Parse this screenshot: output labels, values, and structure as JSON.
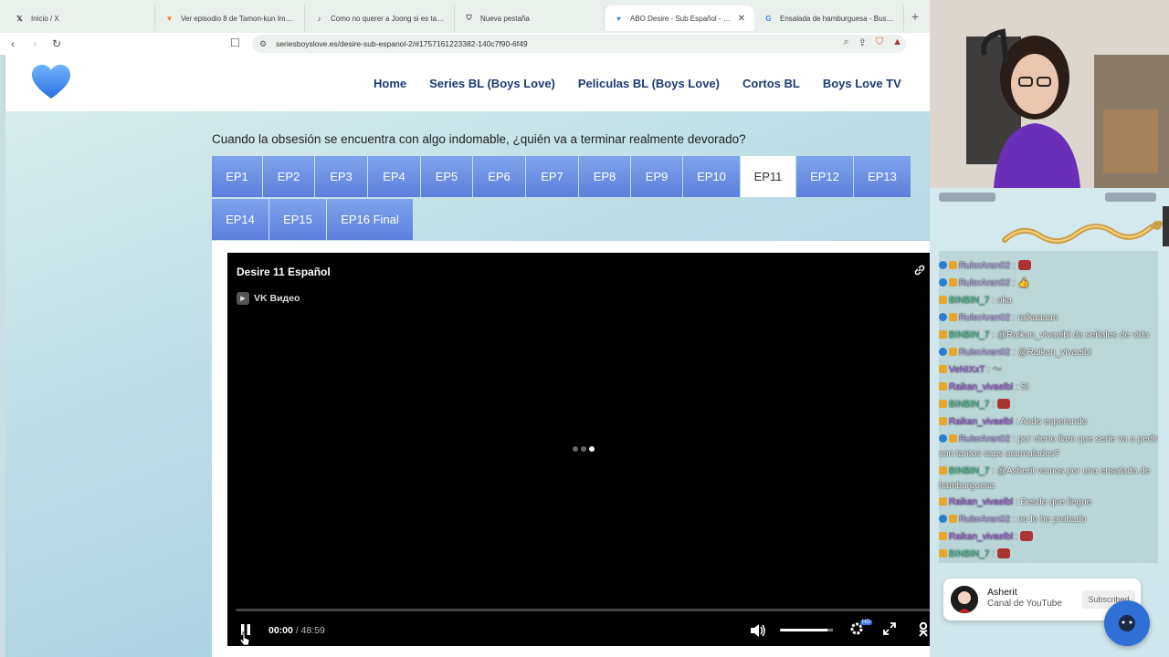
{
  "browser": {
    "tabs": [
      {
        "title": "Inicio / X",
        "favicon": "x-logo-icon",
        "active": false
      },
      {
        "title": "Ver episodio 8 de Tamon-kun Ima Do",
        "favicon": "crunchyroll-icon",
        "active": false
      },
      {
        "title": "Como no querer a Joong si es tan pr",
        "favicon": "tiktok-icon",
        "active": false
      },
      {
        "title": "Nueva pestaña",
        "favicon": "shield-icon",
        "active": false
      },
      {
        "title": "ABO Desire - Sub Español - Serie",
        "favicon": "heart-icon",
        "active": true
      },
      {
        "title": "Ensalada de hamburguesa - Buscar c",
        "favicon": "google-icon",
        "active": false
      }
    ],
    "new_tab": "+",
    "close_tab": "✕",
    "url": "seriesboyslove.es/desire-sub-espanol-2/#1757161223382-140c7f90-6f49"
  },
  "site": {
    "menu": [
      "Home",
      "Series BL (Boys Love)",
      "Peliculas BL (Boys Love)",
      "Cortos BL",
      "Boys Love TV"
    ],
    "tagline": "Cuando la obsesión se encuentra con algo indomable, ¿quién va a terminar realmente devorado?",
    "episodes": [
      "EP1",
      "EP2",
      "EP3",
      "EP4",
      "EP5",
      "EP6",
      "EP7",
      "EP8",
      "EP9",
      "EP10",
      "EP11",
      "EP12",
      "EP13",
      "EP14",
      "EP15",
      "EP16 Final"
    ],
    "active_episode": "EP11",
    "accent_color": "#5b7fdc"
  },
  "player": {
    "title": "Desire 11 Español",
    "source": "VK Видео",
    "current_time": "00:00",
    "separator": " / ",
    "duration": "48:59",
    "volume": 0.9,
    "quality_badge": "HD"
  },
  "chat": {
    "messages": [
      {
        "user": "RulerAran02",
        "text": "",
        "color": "ruler"
      },
      {
        "user": "RulerAran02",
        "text": "",
        "color": "ruler"
      },
      {
        "user": "BINBIN_7",
        "text": "oka",
        "color": "binbin"
      },
      {
        "user": "RulerAran02",
        "text": "raikaaaan",
        "color": "ruler"
      },
      {
        "user": "BINBIN_7",
        "text": "@Raikan_vivaelbl da señales de vida",
        "color": "binbin"
      },
      {
        "user": "RulerAran02",
        "text": "@Raikan_vivaelbl",
        "color": "ruler"
      },
      {
        "user": "VeNIXxT",
        "text": "",
        "color": "venix"
      },
      {
        "user": "Raikan_vivaelbl",
        "text": "Si",
        "color": "raikan"
      },
      {
        "user": "BINBIN_7",
        "text": "",
        "color": "binbin"
      },
      {
        "user": "Raikan_vivaelbl",
        "text": "Ando esperando",
        "color": "raikan"
      },
      {
        "user": "RulerAran02",
        "text": "por cierto liam que serie va a pedir con tantos caps acumulados?",
        "color": "ruler"
      },
      {
        "user": "BINBIN_7",
        "text": "@Asherit vamos por una ensalada de hamburguesa",
        "color": "binbin"
      },
      {
        "user": "Raikan_vivaelbl",
        "text": "Desde que llegue",
        "color": "raikan"
      },
      {
        "user": "RulerAran02",
        "text": "no lo he probado",
        "color": "ruler"
      },
      {
        "user": "Raikan_vivaelbl",
        "text": "",
        "color": "raikan"
      },
      {
        "user": "BINBIN_7",
        "text": "",
        "color": "binbin"
      }
    ],
    "separator": " : "
  },
  "subscribe_card": {
    "name": "Asherit",
    "channel": "Canal de YouTube",
    "button": "Subscribed"
  }
}
